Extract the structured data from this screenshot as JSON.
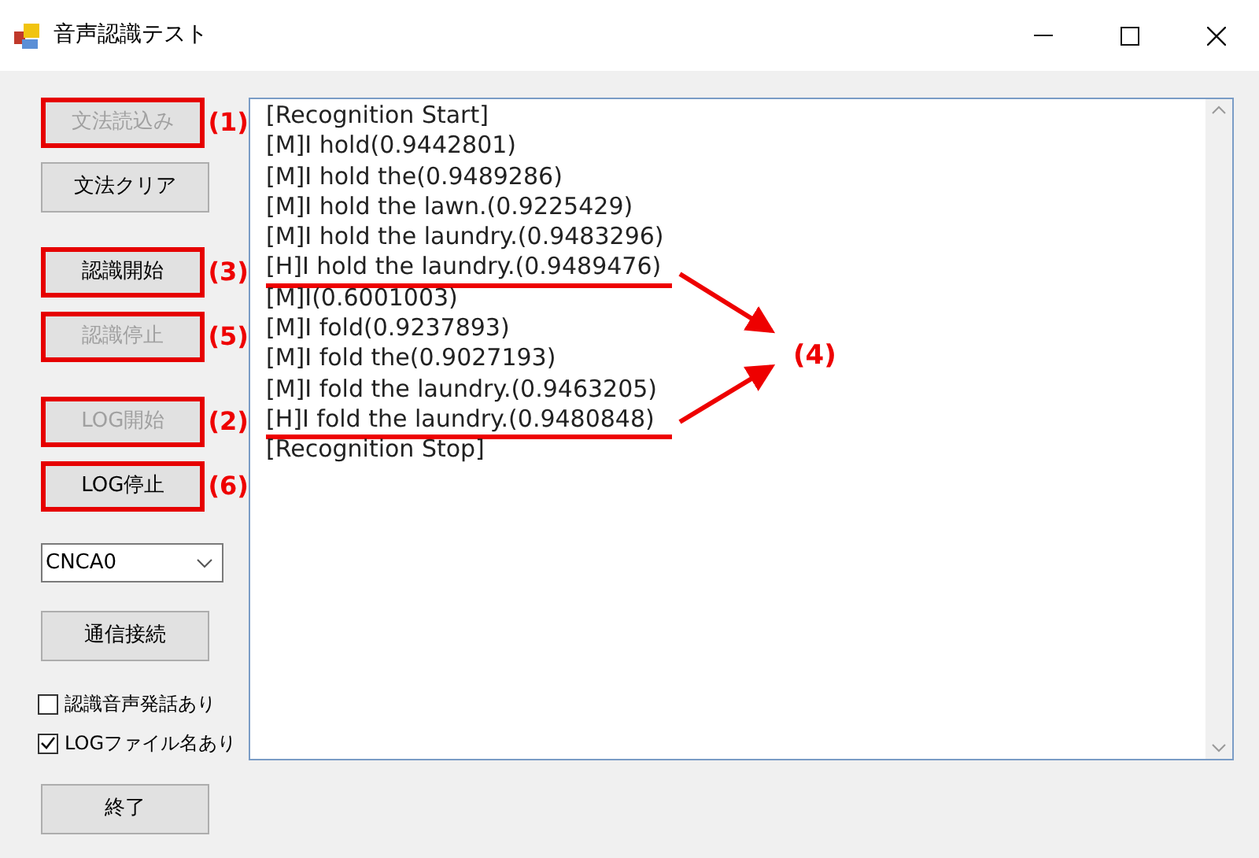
{
  "window": {
    "title": "音声認識テスト"
  },
  "button_groups": [
    [
      {
        "label": "文法読込み",
        "disabled": true,
        "highlighted": true,
        "annotation": "(1)"
      },
      {
        "label": "文法クリア",
        "disabled": false,
        "highlighted": false
      }
    ],
    [
      {
        "label": "認識開始",
        "disabled": false,
        "highlighted": true,
        "annotation": "(3)"
      },
      {
        "label": "認識停止",
        "disabled": true,
        "highlighted": true,
        "annotation": "(5)"
      }
    ],
    [
      {
        "label": "LOG開始",
        "disabled": true,
        "highlighted": true,
        "annotation": "(2)"
      },
      {
        "label": "LOG停止",
        "disabled": false,
        "highlighted": true,
        "annotation": "(6)"
      }
    ]
  ],
  "port_select": {
    "value": "CNCA0"
  },
  "connect_button": {
    "label": "通信接続"
  },
  "checkboxes": [
    {
      "label": "認識音声発話あり",
      "checked": false
    },
    {
      "label": "LOGファイル名あり",
      "checked": true
    }
  ],
  "exit_button": {
    "label": "終了"
  },
  "log_lines": [
    {
      "text": "[Recognition Start]",
      "underlined": false
    },
    {
      "text": "[M]I hold(0.9442801)",
      "underlined": false
    },
    {
      "text": "[M]I hold the(0.9489286)",
      "underlined": false
    },
    {
      "text": "[M]I hold the lawn.(0.9225429)",
      "underlined": false
    },
    {
      "text": "[M]I hold the laundry.(0.9483296)",
      "underlined": false
    },
    {
      "text": "[H]I hold the laundry.(0.9489476)",
      "underlined": true
    },
    {
      "text": "[M]I(0.6001003)",
      "underlined": false
    },
    {
      "text": "[M]I fold(0.9237893)",
      "underlined": false
    },
    {
      "text": "[M]I fold the(0.9027193)",
      "underlined": false
    },
    {
      "text": "[M]I fold the laundry.(0.9463205)",
      "underlined": false
    },
    {
      "text": "[H]I fold the laundry.(0.9480848)",
      "underlined": true
    },
    {
      "text": "[Recognition Stop]",
      "underlined": false
    }
  ],
  "callout": {
    "label": "(4)"
  }
}
